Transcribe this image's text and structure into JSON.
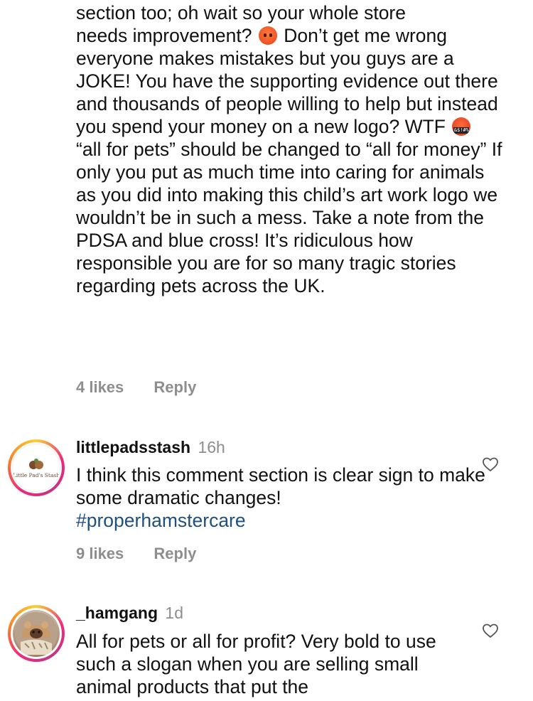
{
  "comments": [
    {
      "lines_before_emoji1": "section too; oh wait so your whole store",
      "text_segment_1": "needs improvement?",
      "text_segment_2": "Don’t get me",
      "text_segment_3": "wrong everyone makes mistakes but you guys are a JOKE! You have the supporting evidence out there and thousands of people willing to help but instead you spend your money on a new logo? WTF",
      "text_segment_4": "“all for pets” should be changed to “all for money” If only you put as much time into caring for animals as you did into making this child’s art work logo we wouldn’t be in such a mess. Take a note from the PDSA and blue cross! It’s ridiculous how responsible you are for so many tragic stories regarding pets across the UK.",
      "likes": "4 likes",
      "reply": "Reply",
      "emoji_1": "pouting-face",
      "emoji_2": "face-with-symbols-on-mouth",
      "emoji_2_glyphs": "&$!#%"
    },
    {
      "username": "littlepadsstash",
      "time": "16h",
      "avatar_text": "Little Pad's Stash",
      "text": "I think this comment section is clear sign to make some dramatic changes!",
      "hashtag": "#properhamstercare",
      "likes": "9 likes",
      "reply": "Reply"
    },
    {
      "username": "_hamgang",
      "time": "1d",
      "text": "All for pets or all for profit? Very bold to use such a slogan when you are selling small animal products that put the"
    }
  ],
  "icons": {
    "like": "heart-outline-icon"
  },
  "colors": {
    "hashtag": "#1f4f7f",
    "meta_gray": "#8e8e8e",
    "ring_start": "#f9ce34",
    "ring_mid": "#ee2a7b"
  }
}
